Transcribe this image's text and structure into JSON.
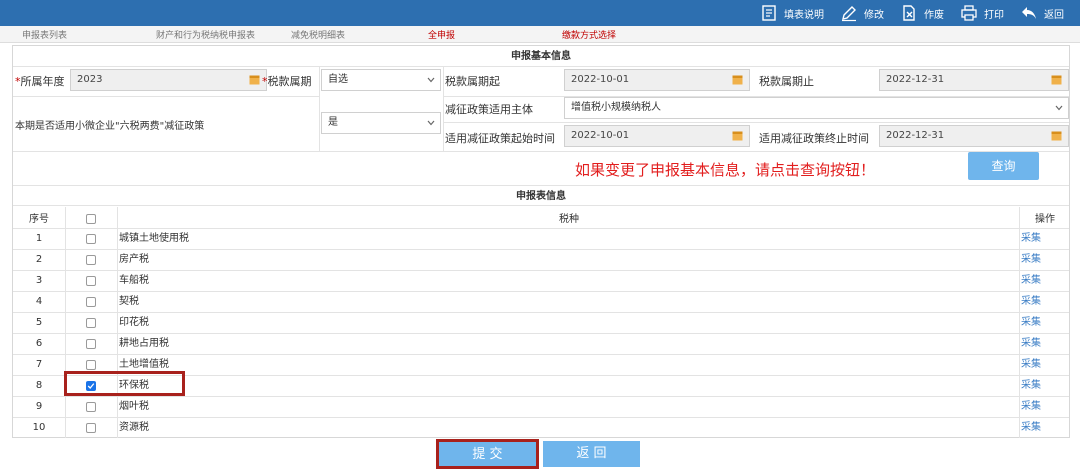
{
  "toolbar": {
    "items": [
      {
        "label": "填表说明",
        "icon": "document-icon"
      },
      {
        "label": "修改",
        "icon": "pencil-icon"
      },
      {
        "label": "作废",
        "icon": "void-icon"
      },
      {
        "label": "打印",
        "icon": "printer-icon"
      },
      {
        "label": "返回",
        "icon": "back-arrow-icon"
      }
    ]
  },
  "tabs": [
    "申报表列表",
    "财产和行为税纳税申报表",
    "减免税明细表",
    "全申报",
    "缴款方式选择"
  ],
  "basic_info": {
    "title": "申报基本信息",
    "year_label": "所属年度",
    "year_value": "2023",
    "period_label": "税款属期",
    "period_value": "自选",
    "start_label": "税款属期起",
    "start_value": "2022-10-01",
    "end_label": "税款属期止",
    "end_value": "2022-12-31",
    "policy_subject_label": "减征政策适用主体",
    "policy_subject_value": "增值税小规模纳税人",
    "six_tax_label": "本期是否适用小微企业\"六税两费\"减征政策",
    "six_tax_value": "是",
    "policy_start_label": "适用减征政策起始时间",
    "policy_start_value": "2022-10-01",
    "policy_end_label": "适用减征政策终止时间",
    "policy_end_value": "2022-12-31",
    "notice": "如果变更了申报基本信息，请点击查询按钮！",
    "query_button": "查询"
  },
  "table": {
    "title": "申报表信息",
    "col_no": "序号",
    "col_tax": "税种",
    "col_op": "操作",
    "rows": [
      {
        "no": "1",
        "tax": "城镇土地使用税",
        "checked": false,
        "op": "采集"
      },
      {
        "no": "2",
        "tax": "房产税",
        "checked": false,
        "op": "采集"
      },
      {
        "no": "3",
        "tax": "车船税",
        "checked": false,
        "op": "采集"
      },
      {
        "no": "4",
        "tax": "契税",
        "checked": false,
        "op": "采集"
      },
      {
        "no": "5",
        "tax": "印花税",
        "checked": false,
        "op": "采集"
      },
      {
        "no": "6",
        "tax": "耕地占用税",
        "checked": false,
        "op": "采集"
      },
      {
        "no": "7",
        "tax": "土地增值税",
        "checked": false,
        "op": "采集"
      },
      {
        "no": "8",
        "tax": "环保税",
        "checked": true,
        "op": "采集"
      },
      {
        "no": "9",
        "tax": "烟叶税",
        "checked": false,
        "op": "采集"
      },
      {
        "no": "10",
        "tax": "资源税",
        "checked": false,
        "op": "采集"
      }
    ]
  },
  "actions": {
    "submit": "提 交",
    "back": "返 回"
  },
  "colors": {
    "header_bar": "#2d6fb0",
    "button": "#6fb5ec",
    "highlight": "#a8211c",
    "notice": "#e21e1e",
    "link": "#3d7fc6"
  }
}
